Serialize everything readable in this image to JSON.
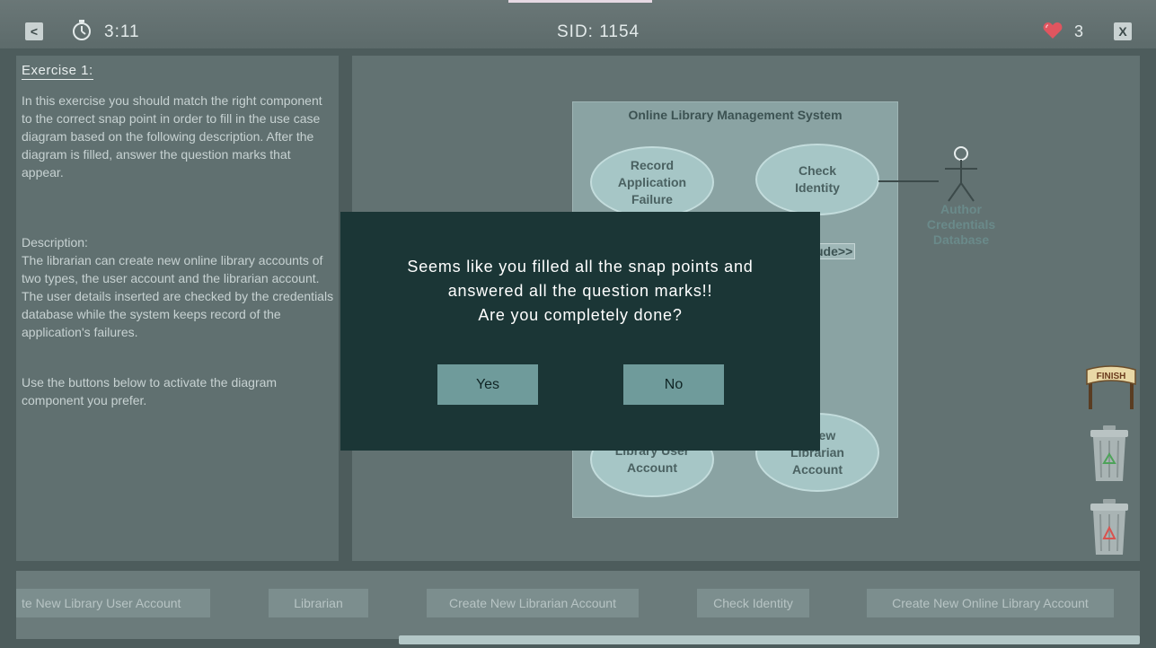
{
  "topbar": {
    "back_label": "<",
    "close_label": "X",
    "timer": "3:11",
    "sid": "SID: 1154",
    "lives": "3"
  },
  "exercise": {
    "title": "Exercise 1:",
    "instructions": "In this exercise you should match the right component to the correct snap point in order to fill in the use case diagram based on the following description. After the diagram is filled, answer the question marks that appear.",
    "description_heading": "Description:",
    "description": "The librarian can create new online library accounts of two types, the user account and the librarian account. The user details inserted are checked by the credentials database while the system keeps record of the application's failures.",
    "hint": "Use the buttons below to activate the diagram component you prefer."
  },
  "diagram": {
    "system_title": "Online Library Management System",
    "usecases": {
      "record_failure": "Record\nApplication\nFailure",
      "check_identity": "Check\nIdentity",
      "library_user_account": "Library User\nAccount",
      "librarian_account": "e New\nLibrarian\nAccount"
    },
    "include_label": "ude>>",
    "actor_label": "Author\nCredentials\nDatabase"
  },
  "dialog": {
    "message": "Seems like you filled all the snap points and\nanswered all the question marks!!\nAre you completely done?",
    "yes_label": "Yes",
    "no_label": "No"
  },
  "tools": {
    "finish_label": "FINISH"
  },
  "bottom_components": [
    "te New Library User Account",
    "Librarian",
    "Create New Librarian Account",
    "Check Identity",
    "Create New Online Library Account"
  ],
  "colors": {
    "dialog_bg": "#1b3636",
    "dialog_button": "#6f9b9b",
    "usecase_fill": "#a6c6c6",
    "heart": "#e0555f"
  }
}
